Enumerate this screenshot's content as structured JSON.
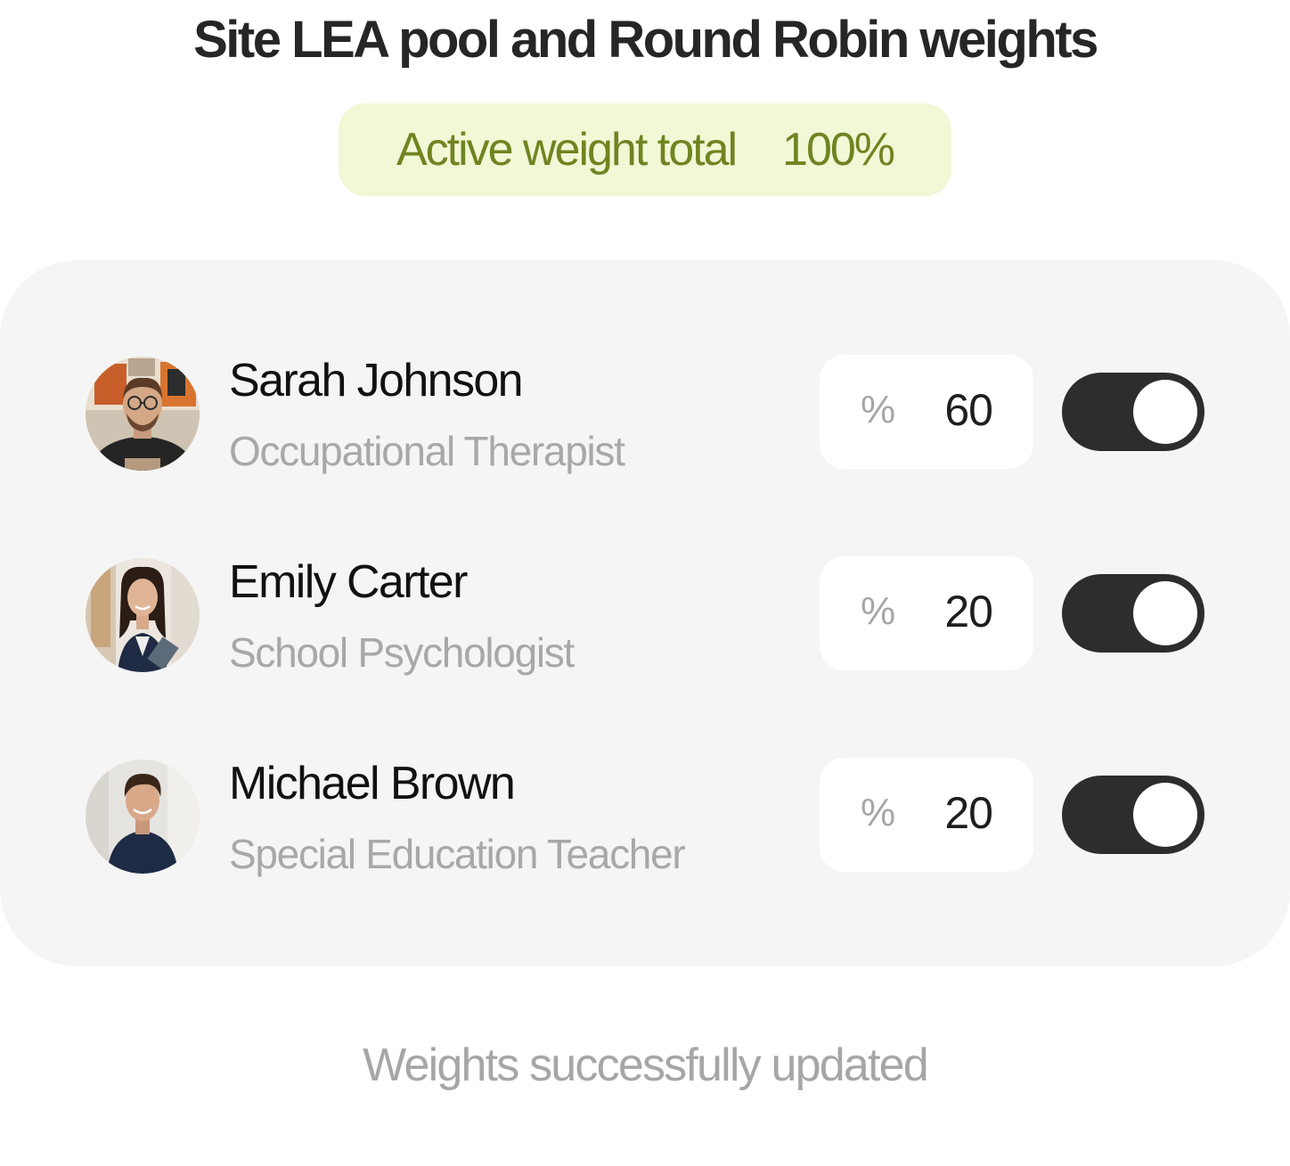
{
  "title": "Site LEA pool and Round Robin weights",
  "total": {
    "label": "Active weight total",
    "value": "100%"
  },
  "members": [
    {
      "name": "Sarah Johnson",
      "role": "Occupational Therapist",
      "percent_symbol": "%",
      "weight": "60",
      "active": true,
      "avatar_icon": "avatar-photo"
    },
    {
      "name": "Emily Carter",
      "role": "School Psychologist",
      "percent_symbol": "%",
      "weight": "20",
      "active": true,
      "avatar_icon": "avatar-photo"
    },
    {
      "name": "Michael Brown",
      "role": "Special Education Teacher",
      "percent_symbol": "%",
      "weight": "20",
      "active": true,
      "avatar_icon": "avatar-photo"
    }
  ],
  "status": "Weights successfully updated",
  "colors": {
    "pill_background": "#f2f7d6",
    "pill_text": "#6f8420",
    "toggle_on": "#2d2d2d",
    "card_background": "#f5f5f5"
  }
}
